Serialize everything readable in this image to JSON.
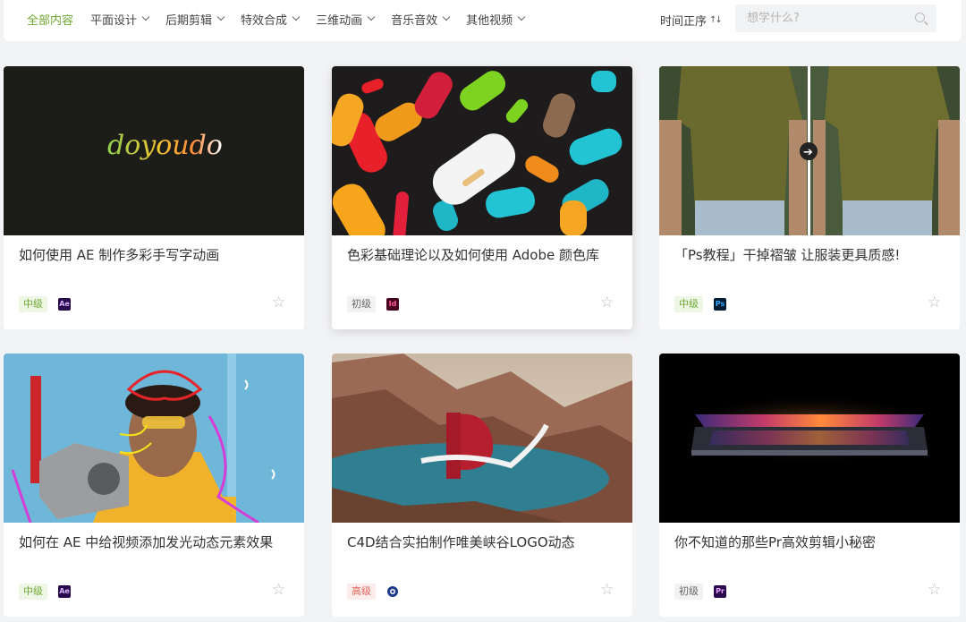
{
  "nav": {
    "items": [
      {
        "label": "全部内容",
        "active": true
      },
      {
        "label": "平面设计"
      },
      {
        "label": "后期剪辑"
      },
      {
        "label": "特效合成"
      },
      {
        "label": "三维动画"
      },
      {
        "label": "音乐音效"
      },
      {
        "label": "其他视频"
      }
    ],
    "sort_label": "时间正序",
    "sort_icon": "sort-ascending-icon",
    "search_placeholder": "想学什么?"
  },
  "cards": [
    {
      "title": "如何使用 AE 制作多彩手写字动画",
      "level": "中级",
      "software": "Ae",
      "image_text": "doyoudo"
    },
    {
      "title": "色彩基础理论以及如何使用 Adobe 颜色库",
      "level": "初级",
      "software": "Id"
    },
    {
      "title": "「Ps教程」干掉褶皱 让服装更具质感!",
      "level": "中级",
      "software": "Ps"
    },
    {
      "title": "如何在 AE 中给视频添加发光动态元素效果",
      "level": "中级",
      "software": "Ae"
    },
    {
      "title": "C4D结合实拍制作唯美峡谷LOGO动态",
      "level": "高级",
      "software": "c4d-icon"
    },
    {
      "title": "你不知道的那些Pr高效剪辑小秘密",
      "level": "初级",
      "software": "Pr"
    }
  ],
  "colors": {
    "accent": "#6fa832",
    "level_mid": "#6fa832",
    "level_high": "#e2655b"
  }
}
